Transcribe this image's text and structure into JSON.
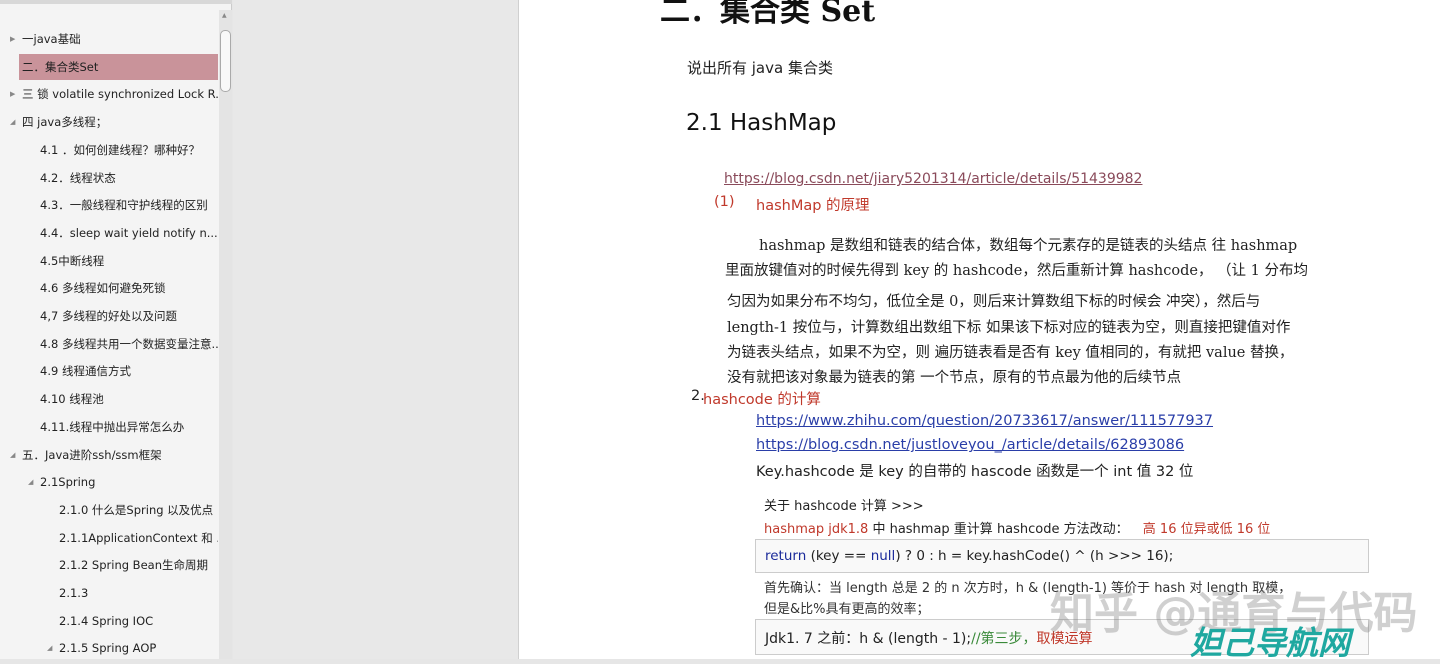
{
  "sidebar": {
    "items": [
      {
        "label": "一java基础",
        "level": 0,
        "expander": "collapsed"
      },
      {
        "label": "二．集合类Set",
        "level": 0,
        "expander": "collapsed",
        "selected": true
      },
      {
        "label": "三 锁 volatile synchronized Lock R...",
        "level": 0,
        "expander": "collapsed"
      },
      {
        "label": "四 java多线程；",
        "level": 0,
        "expander": "expanded"
      },
      {
        "label": "4.1 ．如何创建线程？哪种好？",
        "level": 1
      },
      {
        "label": "4.2．线程状态",
        "level": 1
      },
      {
        "label": "4.3．一般线程和守护线程的区别",
        "level": 1
      },
      {
        "label": "4.4．sleep  wait  yield notify n...",
        "level": 1
      },
      {
        "label": "4.5中断线程",
        "level": 1
      },
      {
        "label": "4.6 多线程如何避免死锁",
        "level": 1
      },
      {
        "label": "4,7 多线程的好处以及问题",
        "level": 1
      },
      {
        "label": "4.8 多线程共用一个数据变量注意...",
        "level": 1
      },
      {
        "label": "4.9 线程通信方式",
        "level": 1
      },
      {
        "label": "4.10  线程池",
        "level": 1
      },
      {
        "label": "4.11.线程中抛出异常怎么办",
        "level": 1
      },
      {
        "label": "五．Java进阶ssh/ssm框架",
        "level": 0,
        "expander": "expanded"
      },
      {
        "label": "2.1Spring",
        "level": 1,
        "expander": "expanded"
      },
      {
        "label": "2.1.0 什么是Spring 以及优点",
        "level": 2
      },
      {
        "label": "2.1.1ApplicationContext 和 ...",
        "level": 2
      },
      {
        "label": "2.1.2 Spring Bean生命周期",
        "level": 2
      },
      {
        "label": "2.1.3",
        "level": 2
      },
      {
        "label": "2.1.4 Spring IOC",
        "level": 2
      },
      {
        "label": "2.1.5 Spring AOP",
        "level": 2,
        "expander": "expanded"
      }
    ],
    "selected_color": "#c9939a"
  },
  "doc": {
    "heading": "二．集合类 Set",
    "intro": "说出所有 java 集合类",
    "h2": "2.1 HashMap",
    "link1": "https://blog.csdn.net/jiary5201314/article/details/51439982",
    "sec1_num": "(1)",
    "sec1_title": "hashMap 的原理",
    "para": [
      "hashmap 是数组和链表的结合体，数组每个元素存的是链表的头结点 往 hashmap",
      "里面放键值对的时候先得到 key 的 hashcode，然后重新计算 hashcode，  （让 1 分布均",
      "匀因为如果分布不均匀，低位全是 0，则后来计算数组下标的时候会 冲突），然后与",
      "length-1 按位与，计算数组出数组下标 如果该下标对应的链表为空，则直接把键值对作",
      "为链表头结点，如果不为空，则 遍历链表看是否有 key 值相同的，有就把 value 替换，",
      "没有就把该对象最为链表的第 一个节点，原有的节点最为他的后续节点"
    ],
    "sec2_num": "2.",
    "sec2_title": "hashcode 的计算",
    "link2": "https://www.zhihu.com/question/20733617/answer/111577937",
    "link3": "https://blog.csdn.net/justloveyou_/article/details/62893086",
    "keyline": "Key.hashcode 是 key 的自带的 hascode 函数是一个 int 值 32 位",
    "about": "关于 hashcode 计算   >>>",
    "jdk18_a": "hashmap jdk1.8",
    "jdk18_b": " 中 hashmap 重计算 hashcode 方法改动：",
    "jdk18_c": "高 16 位异或低 16 位",
    "code1_kw1": "return",
    "code1_a": " (key == ",
    "code1_kw2": "null",
    "code1_b": ") ? 0 : h = key.hashCode() ^ (h >>> 16);",
    "confirm1": "首先确认：当 length 总是 2 的 n 次方时，h & (length-1) 等价于 hash 对 length 取模，",
    "confirm2": "但是&比%具有更高的效率；",
    "code2_a": "Jdk1. 7 之前：h & (length - 1);",
    "code2_cm": "//第三步，",
    "code2_red": "取模运算"
  },
  "watermark": {
    "text1": "知乎 @通育与代码",
    "text2": "妲己导航网",
    "color": "#1fa8a0"
  },
  "colors": {
    "accent_red": "#c0392b",
    "link": "#2a3ea8"
  }
}
